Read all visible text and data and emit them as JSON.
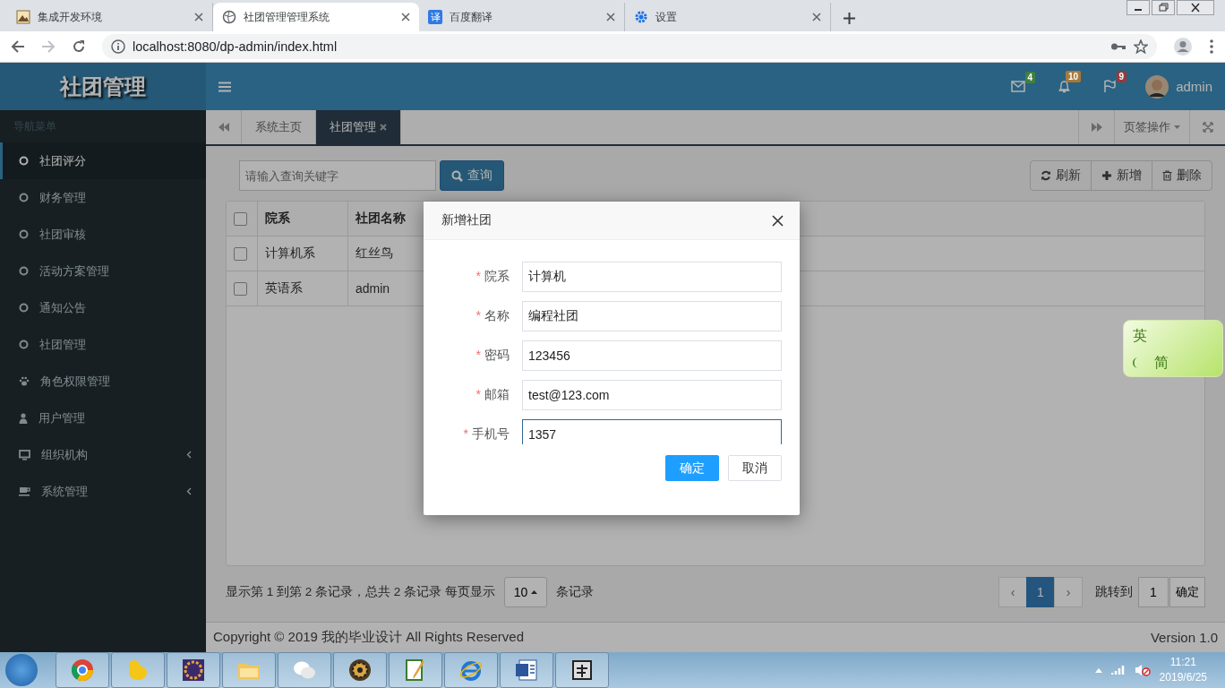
{
  "browser": {
    "tabs": [
      {
        "title": "集成开发环境",
        "kind": "image",
        "selected": false
      },
      {
        "title": "社团管理管理系统",
        "kind": "globe",
        "selected": true
      },
      {
        "title": "百度翻译",
        "kind": "translate",
        "icon_text": "译",
        "selected": false
      },
      {
        "title": "设置",
        "kind": "gear",
        "selected": false
      }
    ],
    "url": "localhost:8080/dp-admin/index.html"
  },
  "header": {
    "brand": "社团管理",
    "notifications": [
      {
        "kind": "mail",
        "count": "4",
        "color": "#40813f"
      },
      {
        "kind": "bell",
        "count": "10",
        "color": "#a87937"
      },
      {
        "kind": "flag",
        "count": "9",
        "color": "#983a37"
      }
    ],
    "user": "admin"
  },
  "sidebar": {
    "heading": "导航菜单",
    "items": [
      {
        "label": "社团评分",
        "kind": "circle",
        "selected": true,
        "collapsible": false
      },
      {
        "label": "财务管理",
        "kind": "circle",
        "selected": false,
        "collapsible": false
      },
      {
        "label": "社团审核",
        "kind": "circle",
        "selected": false,
        "collapsible": false
      },
      {
        "label": "活动方案管理",
        "kind": "circle",
        "selected": false,
        "collapsible": false
      },
      {
        "label": "通知公告",
        "kind": "circle",
        "selected": false,
        "collapsible": false
      },
      {
        "label": "社团管理",
        "kind": "circle",
        "selected": false,
        "collapsible": false
      },
      {
        "label": "角色权限管理",
        "kind": "paw",
        "selected": false,
        "collapsible": false
      },
      {
        "label": "用户管理",
        "kind": "user",
        "selected": false,
        "collapsible": false
      },
      {
        "label": "组织机构",
        "kind": "desktop",
        "selected": false,
        "collapsible": true
      },
      {
        "label": "系统管理",
        "kind": "coffee",
        "selected": false,
        "collapsible": true
      }
    ]
  },
  "page_tabs": {
    "tabs": [
      {
        "label": "系统主页",
        "selected": false,
        "closable": false
      },
      {
        "label": "社团管理",
        "selected": true,
        "closable": true
      }
    ],
    "menu": "页签操作"
  },
  "toolbar": {
    "search": {
      "placeholder": "请输入查询关键字"
    },
    "search_button": "查询",
    "buttons": [
      {
        "kind": "refresh",
        "label": "刷新"
      },
      {
        "kind": "plus",
        "label": "新增"
      },
      {
        "kind": "trash",
        "label": "删除"
      }
    ]
  },
  "table": {
    "all_checked": false,
    "columns": [
      "院系",
      "社团名称"
    ],
    "rows": [
      {
        "checked": false,
        "cells": [
          "计算机系",
          "红丝鸟"
        ]
      },
      {
        "checked": false,
        "cells": [
          "英语系",
          "admin"
        ]
      }
    ]
  },
  "pagination": {
    "summary": "显示第 1 到第 2 条记录，总共 2 条记录 每页显示",
    "page_size": "10",
    "suffix": "条记录",
    "prev": "‹",
    "pages": [
      {
        "label": "1",
        "selected": true
      }
    ],
    "next": "›",
    "jump_label": "跳转到",
    "jump_value": "1",
    "jump_button": "确定"
  },
  "footer": {
    "copyright": "Copyright © 2019 我的毕业设计 All Rights Reserved",
    "version": "Version 1.0"
  },
  "modal": {
    "title": "新增社团",
    "fields": [
      {
        "required_mark": "*",
        "label": "院系",
        "value": "计算机",
        "focused": false
      },
      {
        "required_mark": "*",
        "label": "名称",
        "value": "编程社团",
        "focused": false
      },
      {
        "required_mark": "*",
        "label": "密码",
        "value": "123456",
        "focused": false
      },
      {
        "required_mark": "*",
        "label": "邮箱",
        "value": "test@123.com",
        "focused": false
      },
      {
        "required_mark": "*",
        "label": "手机号",
        "value": "1357",
        "focused": true
      }
    ],
    "buttons": [
      {
        "label": "确定",
        "kind": "primary"
      },
      {
        "label": "取消",
        "kind": "default"
      }
    ]
  },
  "ime": {
    "lang": "英",
    "mode": "简"
  },
  "taskbar": {
    "apps": [
      {
        "kind": "chrome"
      },
      {
        "kind": "duck"
      },
      {
        "kind": "ide"
      },
      {
        "kind": "folder"
      },
      {
        "kind": "wechat"
      },
      {
        "kind": "wheel"
      },
      {
        "kind": "notepad"
      },
      {
        "kind": "ie"
      },
      {
        "kind": "word"
      },
      {
        "kind": "tool"
      }
    ],
    "time": "11:21",
    "date": "2019/6/25"
  }
}
